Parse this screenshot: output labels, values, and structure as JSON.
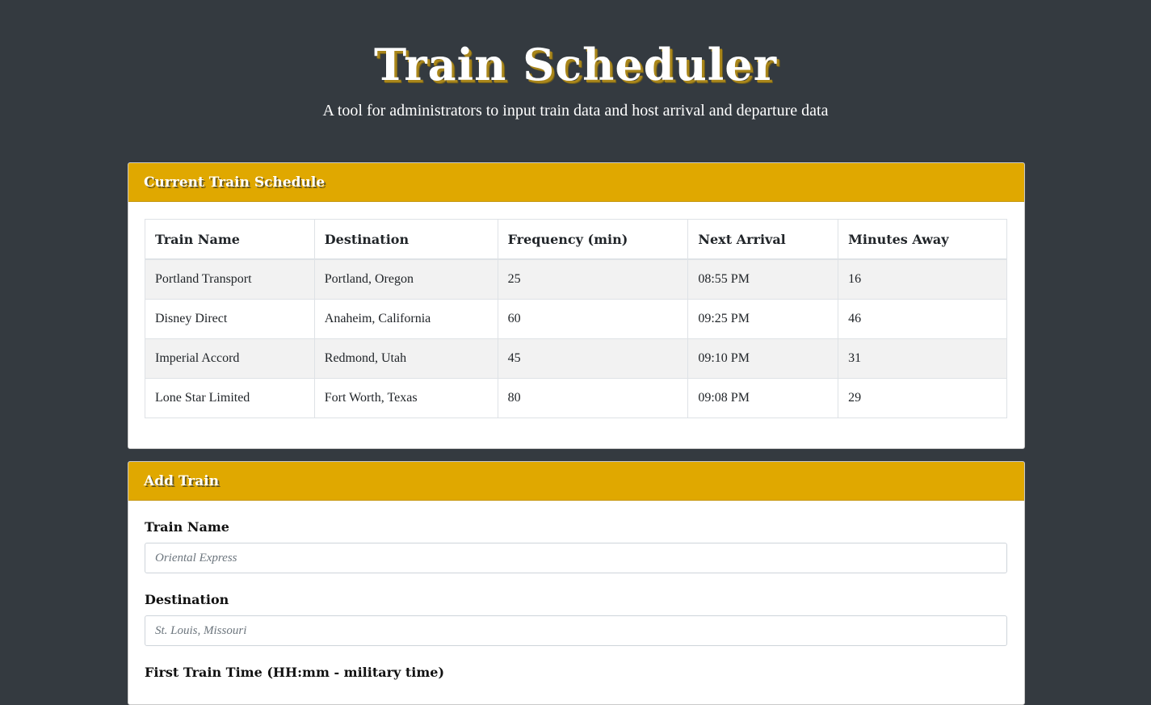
{
  "header": {
    "title": "Train Scheduler",
    "subtitle": "A tool for administrators to input train data and host arrival and departure data"
  },
  "schedule": {
    "heading": "Current Train Schedule",
    "columns": [
      "Train Name",
      "Destination",
      "Frequency (min)",
      "Next Arrival",
      "Minutes Away"
    ],
    "rows": [
      [
        "Portland Transport",
        "Portland, Oregon",
        "25",
        "08:55 PM",
        "16"
      ],
      [
        "Disney Direct",
        "Anaheim, California",
        "60",
        "09:25 PM",
        "46"
      ],
      [
        "Imperial Accord",
        "Redmond, Utah",
        "45",
        "09:10 PM",
        "31"
      ],
      [
        "Lone Star Limited",
        "Fort Worth, Texas",
        "80",
        "09:08 PM",
        "29"
      ]
    ]
  },
  "add_train": {
    "heading": "Add Train",
    "fields": {
      "train_name": {
        "label": "Train Name",
        "value": "",
        "placeholder": "Oriental Express"
      },
      "destination": {
        "label": "Destination",
        "value": "",
        "placeholder": "St. Louis, Missouri"
      },
      "first_time": {
        "label": "First Train Time (HH:mm - military time)"
      }
    }
  },
  "colors": {
    "background": "#343a40",
    "accent": "#e0a800",
    "title_shadow": "#a9861a"
  }
}
